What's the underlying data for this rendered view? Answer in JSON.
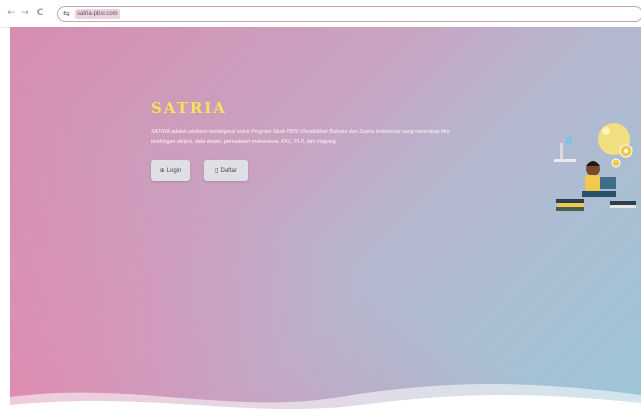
{
  "browser": {
    "back_icon": "←",
    "forward_icon": "→",
    "reload_icon": "C",
    "tune_icon": "⇆",
    "url": "satria-pbsi.com"
  },
  "hero": {
    "title": "SATRIA",
    "description": "SATRIA adalah platform terintegrasi untuk Program Studi PBSI (Pendidikan Bahasa dan Sastra Indonesia) yang mencakup fitur bimbingan skripsi, data dosen, persediaan mahasiswa, KKL, PLP, dan magang.",
    "login_icon": "⊕",
    "login_label": "Login",
    "register_icon": "▯",
    "register_label": "Daftar",
    "colors": {
      "title": "#f3e35a",
      "gradient_start": "#d78cb0",
      "gradient_end": "#9cc6d6"
    }
  },
  "illustration": {
    "icon": "student-reading-lightbulb-icon"
  }
}
